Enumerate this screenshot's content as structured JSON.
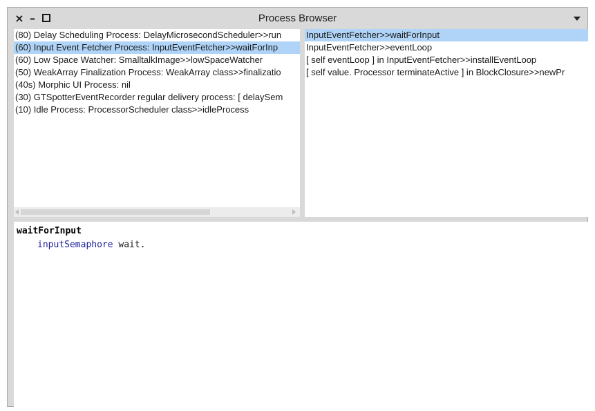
{
  "window": {
    "title": "Process Browser",
    "controls": {
      "close": "×",
      "minimize": "–"
    }
  },
  "process_list": [
    "(80) Delay Scheduling Process: DelayMicrosecondScheduler>>run",
    "(60) Input Event Fetcher Process: InputEventFetcher>>waitForInp",
    "(60) Low Space Watcher: SmalltalkImage>>lowSpaceWatcher",
    "(50) WeakArray Finalization Process: WeakArray class>>finalizatio",
    "(40s) Morphic UI Process: nil",
    "(30) GTSpotterEventRecorder regular delivery process: [ delaySem",
    "(10) Idle Process: ProcessorScheduler class>>idleProcess"
  ],
  "selected_process_index": 1,
  "stack_list": [
    "InputEventFetcher>>waitForInput",
    "InputEventFetcher>>eventLoop",
    "[ self eventLoop ] in InputEventFetcher>>installEventLoop",
    "[  self value. Processor terminateActive ] in BlockClosure>>newPr"
  ],
  "selected_stack_index": 0,
  "code": {
    "selector": "waitForInput",
    "variable": "inputSemaphore",
    "statement_rest": " wait."
  },
  "colors": {
    "selection": "#b0d4f7",
    "variable": "#1d1d9c",
    "chrome": "#d9d9d9"
  }
}
